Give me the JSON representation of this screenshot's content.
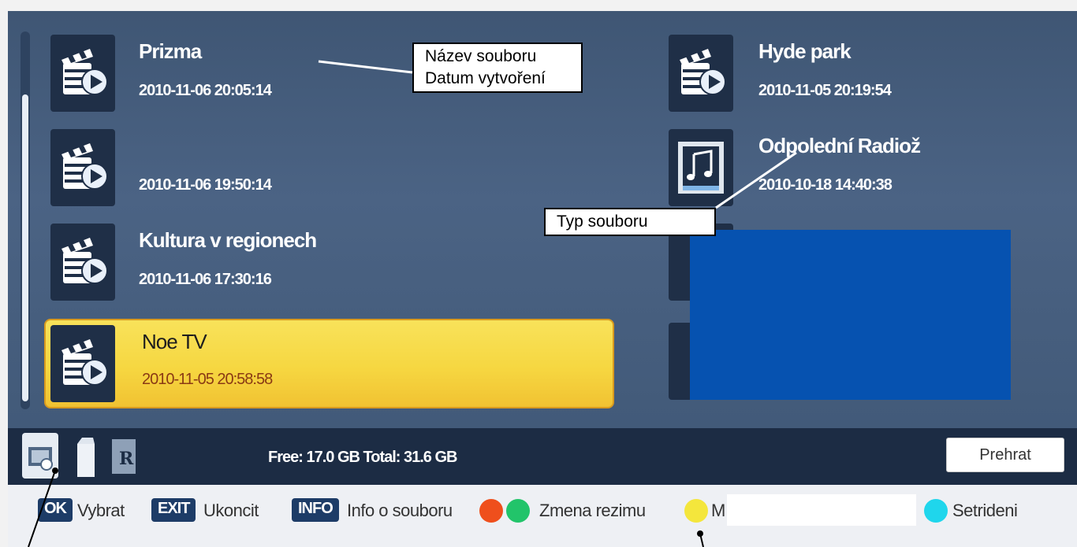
{
  "files": {
    "left": [
      {
        "name": "Prizma",
        "date": "2010-11-06 20:05:14",
        "type": "video-clapper-icon"
      },
      {
        "name": "",
        "date": "2010-11-06 19:50:14",
        "type": "video-clapper-icon"
      },
      {
        "name": "Kultura v regionech",
        "date": "2010-11-06 17:30:16",
        "type": "video-clapper-icon"
      },
      {
        "name": "Noe TV",
        "date": "2010-11-05 20:58:58",
        "type": "video-clapper-icon",
        "selected": true
      }
    ],
    "right": [
      {
        "name": "Hyde park",
        "date": "2010-11-05 20:19:54",
        "type": "video-clapper-icon"
      },
      {
        "name": "Odpolední Radiož",
        "date": "2010-10-18 14:40:38",
        "type": "music-note-icon"
      }
    ]
  },
  "storage": {
    "text": "Free: 17.0 GB  Total: 31.6 GB"
  },
  "buttons": {
    "play": "Prehrat"
  },
  "help": {
    "ok_key": "OK",
    "ok_label": "Vybrat",
    "exit_key": "EXIT",
    "exit_label": "Ukoncit",
    "info_key": "INFO",
    "info_label": "Info o souboru",
    "mode_label": "Zmena rezimu",
    "yellow_label_partial": "M",
    "sort_label": "Setrideni"
  },
  "callouts": {
    "filename": "Název souboru",
    "created": "Datum vytvoření",
    "filetype": "Typ souboru"
  },
  "colors": {
    "screen_bg": "#4b6384",
    "bar_bg": "#1c2c44",
    "selected_bg": "#f6d741",
    "red": "#ef4f1c",
    "green": "#22c46a",
    "yellow": "#f4e63c",
    "cyan": "#1fd6ec",
    "redaction": "#0652b0"
  }
}
